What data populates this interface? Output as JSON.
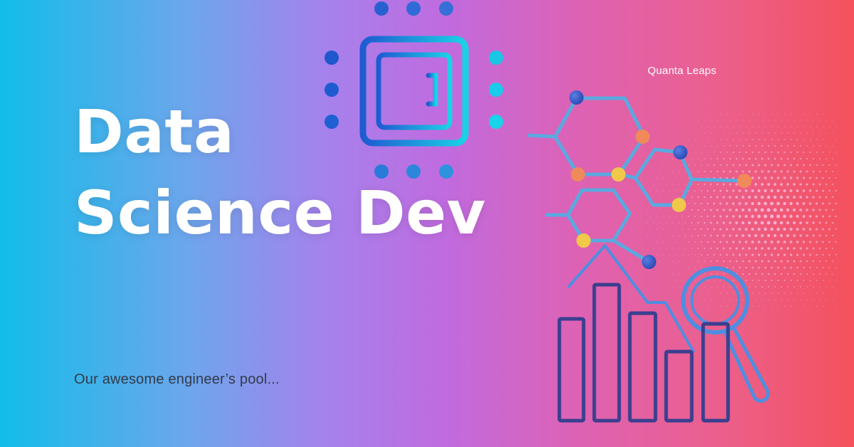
{
  "title": {
    "line1": "Data",
    "line2": "Science Dev"
  },
  "brand": "Quanta Leaps",
  "tagline": "Our awesome engineer’s pool...",
  "icons": [
    "chip-icon",
    "molecule-icon",
    "bar-chart-icon",
    "magnifier-icon",
    "dot-pattern"
  ],
  "colors": {
    "gradient_left": "#12bde9",
    "gradient_mid": "#c06bdf",
    "gradient_right": "#f4515c",
    "title_text": "#ffffff",
    "tagline_text": "#333a4a",
    "chart_stroke": "#3a3f8f",
    "molecule_stroke": "#5aa9e0",
    "node_blue": "#2f55c4",
    "node_orange": "#f08a5a",
    "node_yellow": "#f0c84a"
  }
}
